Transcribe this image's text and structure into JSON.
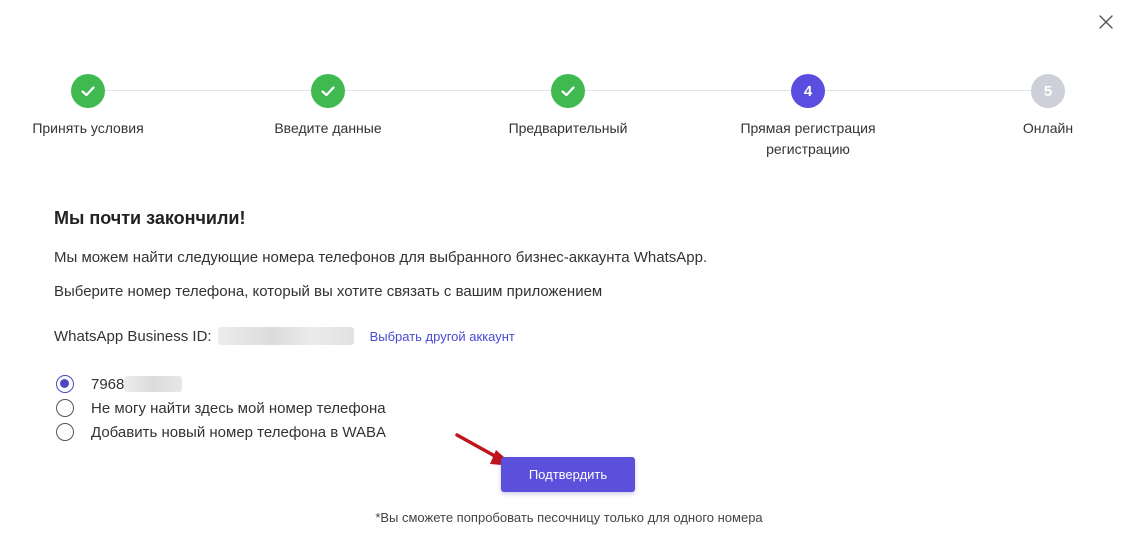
{
  "steps": [
    {
      "label": "Принять условия",
      "status": "done"
    },
    {
      "label": "Введите данные",
      "status": "done"
    },
    {
      "label": "Предварительный",
      "status": "done"
    },
    {
      "label": "Прямая регистрация",
      "label2": "регистрацию",
      "number": "4",
      "status": "active"
    },
    {
      "label": "Онлайн",
      "number": "5",
      "status": "pending"
    }
  ],
  "main": {
    "heading": "Мы почти закончили!",
    "description": "Мы можем найти следующие номера телефонов для выбранного бизнес-аккаунта WhatsApp.",
    "instruction": "Выберите номер телефона, который вы хотите связать с вашим приложением",
    "waba_label": "WhatsApp Business ID:",
    "change_account_link": "Выбрать другой аккаунт"
  },
  "options": [
    {
      "label": "7968",
      "checked": true
    },
    {
      "label": "Не могу найти здесь мой номер телефона",
      "checked": false
    },
    {
      "label": "Добавить новый номер телефона в WABA",
      "checked": false
    }
  ],
  "confirm_label": "Подтвердить",
  "footnote": "*Вы сможете попробовать песочницу только для одного номера",
  "colors": {
    "done": "#3fb950",
    "active": "#5a4ee0",
    "pending": "#cdd0d8",
    "button": "#5a50dc",
    "link": "#4a4ad6",
    "arrow": "#c0141c"
  },
  "icons": [
    "close-icon",
    "check-icon",
    "arrow-icon"
  ]
}
